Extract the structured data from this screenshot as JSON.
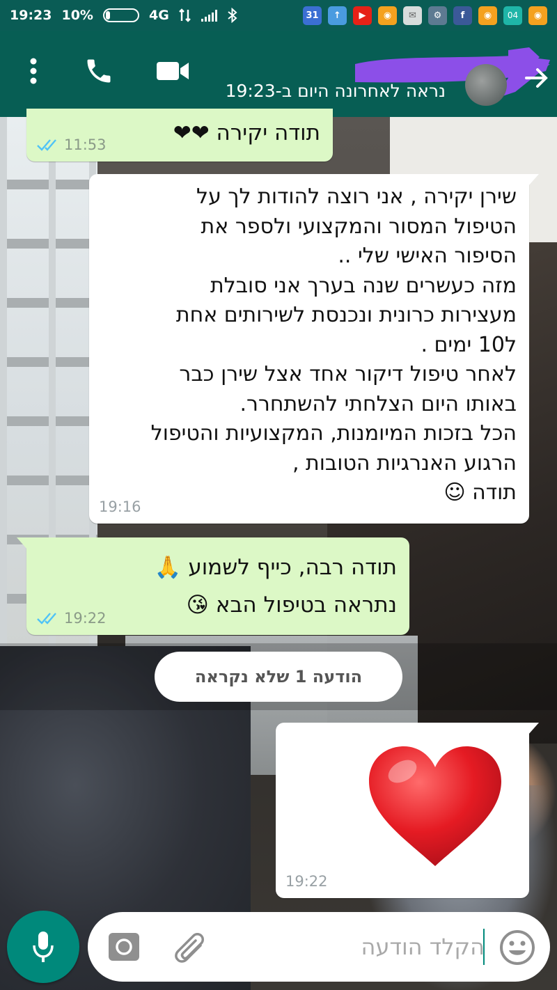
{
  "status_bar": {
    "time": "19:23",
    "battery": "10%",
    "network": "4G"
  },
  "header": {
    "last_seen": "נראה לאחרונה היום ב-19:23"
  },
  "messages": [
    {
      "direction": "out",
      "text": "תודה יקירה ❤❤",
      "time": "11:53"
    },
    {
      "direction": "in",
      "text": "שירן יקירה , אני רוצה להודות לך על\nהטיפול המסור והמקצועי ולספר את\nהסיפור האישי שלי ..\nמזה כעשרים שנה בערך אני סובלת\nמעצירות כרונית ונכנסת לשירותים אחת\nל10 ימים  .\nלאחר טיפול דיקור אחד אצל שירן כבר\nבאותו היום הצלחתי להשתחרר.\nהכל בזכות המיומנות, המקצועיות והטיפול\nהרגוע האנרגיות הטובות ,\nתודה ☺",
      "time": "19:16"
    },
    {
      "direction": "out",
      "text": "תודה רבה, כייף לשמוע 🙏\nנתראה בטיפול הבא 😘",
      "time": "19:22"
    },
    {
      "direction": "in",
      "text": "❤",
      "time": "19:22"
    }
  ],
  "unread_banner": "הודעה 1 שלא נקראה",
  "composer": {
    "placeholder": "הקלד הודעה"
  },
  "colors": {
    "header": "#075e54",
    "status_bar": "#0a5c55",
    "outgoing_bubble": "#dcf8c6",
    "incoming_bubble": "#ffffff",
    "mic_button": "#00897b",
    "read_ticks": "#4fc3f7"
  }
}
